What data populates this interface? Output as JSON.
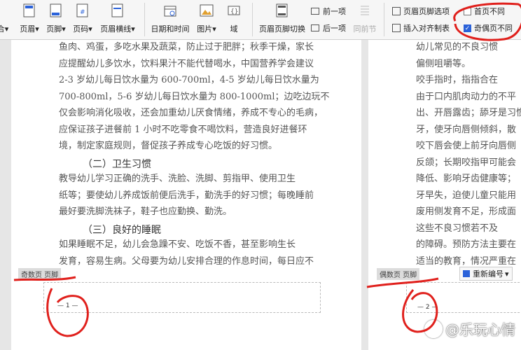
{
  "ribbon": {
    "cut_label": "合",
    "header_label": "页眉",
    "footer_label": "页脚",
    "page_number_label": "页码",
    "header_line_label": "页眉横线",
    "date_time_label": "日期和时间",
    "picture_label": "图片",
    "field_label": "域",
    "switch_label": "页眉页脚切换",
    "prev_label": "前一项",
    "next_label": "后一项",
    "same_as_prev_label": "同前节",
    "options_label": "页眉页脚选项",
    "insert_align_tab_label": "插入对齐制表",
    "first_page_diff_label": "首页不同",
    "odd_even_diff_label": "奇偶页不同",
    "dropdown_arrow": "▾"
  },
  "left_page": {
    "lines": [
      "鱼肉、鸡蛋，多吃水果及蔬菜，防止过于肥胖；秋季干燥，家长",
      "应提醒幼儿多饮水，饮料果汁不能代替喝水，中国营养学会建议",
      "2-3 岁幼儿每日饮水量为 600-700ml，4-5 岁幼儿每日饮水量为",
      "700-800ml，5-6 岁幼儿每日饮水量为 800-1000ml；边吃边玩不",
      "仅会影响消化吸收，还会加重幼儿厌食情绪，养成不专心的毛病，",
      "应保证孩子进餐前 1 小时不吃零食不喝饮料，营造良好进餐环",
      "境，制定家庭规则，督促孩子养成专心吃饭的好习惯。"
    ],
    "heading2": "（二）卫生习惯",
    "lines2": [
      "教导幼儿学习正确的洗手、洗脸、洗脚、剪指甲、使用卫生",
      "纸等；要使幼儿养成饭前便后洗手，勤洗手的好习惯；每晚睡前",
      "最好要洗脚洗袜子，鞋子也应勤换、勤洗。"
    ],
    "heading3": "（三）良好的睡眠",
    "lines3": [
      "如果睡眠不足，幼儿会急躁不安、吃饭不香，甚至影响生长",
      "发育，容易生病。父母要为幼儿安排合理的作息时间，每日应不"
    ],
    "footer_label": "奇数页 页脚",
    "page_number": "— 1 —"
  },
  "right_page": {
    "lines": [
      "幼儿常见的不良习惯",
      "偏侧咀嚼等。",
      "咬手指时，指指合在",
      "由于口内肌肉动力的不平",
      "出、开唇露齿；舔牙是习惯",
      "牙，使牙向唇侧倾斜，散",
      "咬下唇会使上前牙向唇侧",
      "反颌；长期咬指甲可能会",
      "降低、影响牙齿健康等；",
      "牙早失，迫使儿童只能用",
      "废用侧发育不足，形成面",
      "这些不良习惯若不及",
      "的障碍。预防方法主要在",
      "适当的教育，情况严重在"
    ],
    "footer_label": "偶数页 页脚",
    "renumber_label": "重新编号",
    "page_number": "— 2 —"
  },
  "watermark": {
    "text": "@乐玩心情"
  },
  "colors": {
    "annotation_red": "#e0201c",
    "checkbox_blue": "#2b62d9"
  }
}
